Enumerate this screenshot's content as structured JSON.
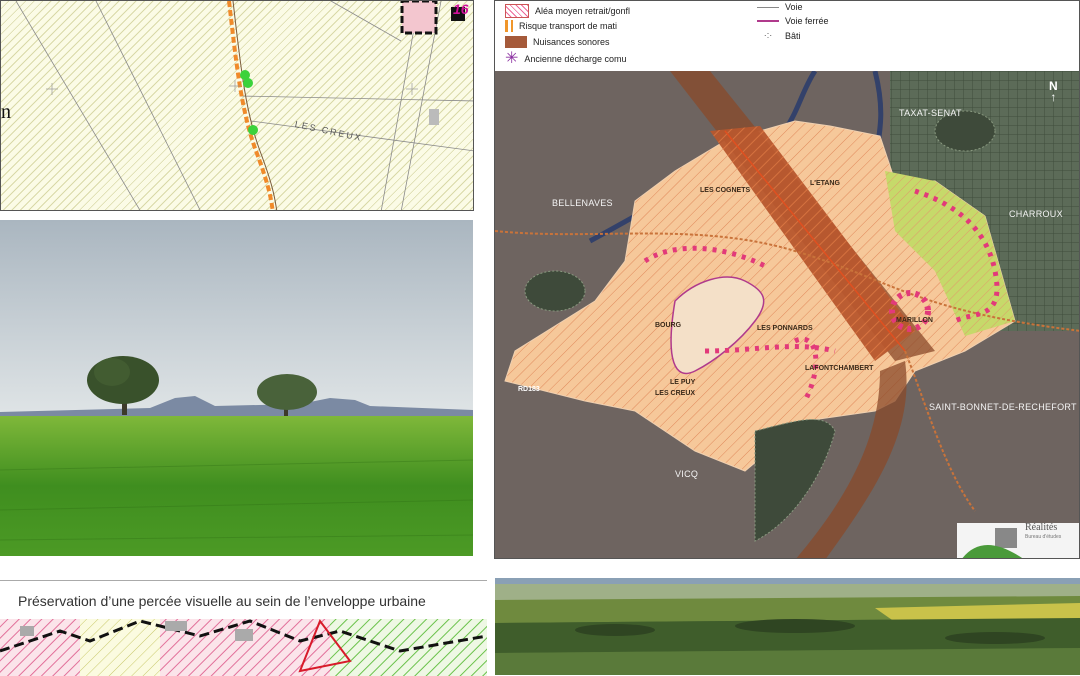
{
  "cadastre": {
    "letter": "n",
    "parcel_number": "16",
    "place_label": "LES CREUX"
  },
  "legend": {
    "items_left": [
      {
        "label": "Aléa moyen retrait/gonfl"
      },
      {
        "label": "Risque transport de mati"
      },
      {
        "label": "Nuisances sonores"
      },
      {
        "label": "Ancienne décharge comu"
      }
    ],
    "items_right": [
      {
        "label": "Voie"
      },
      {
        "label": "Voie ferrée"
      },
      {
        "label": "Bâti"
      }
    ]
  },
  "map": {
    "north": "N",
    "places": {
      "taxat": "TAXAT-SENAT",
      "bellenaves": "BELLENAVES",
      "charroux": "CHARROUX",
      "saint_bonnet": "SAINT-BONNET-DE-RECHEFORT",
      "vicq": "VICQ"
    },
    "localities": {
      "les_cognets": "LES COGNETS",
      "letang": "L'ETANG",
      "bourg": "BOURG",
      "les_ponnards": "LES PONNARDS",
      "marillon": "MARILLON",
      "lafontchambert": "LAFONTCHAMBERT",
      "le_puy": "LE PUY",
      "les_creux": "LES CREUX",
      "rd183": "RD183"
    },
    "logo_text": "Réalités",
    "logo_subtext": "Bureau d'études"
  },
  "zoning": {
    "caption": "Préservation d’une percée visuelle au sein de l’enveloppe urbaine"
  },
  "colors": {
    "zone_fill": "#f6c89a",
    "hazard_band": "#b8572e",
    "noise": "#a55a3a",
    "railway": "#b03a8c",
    "green_zone": "#c6d96a",
    "background_map": "#6e6460"
  }
}
